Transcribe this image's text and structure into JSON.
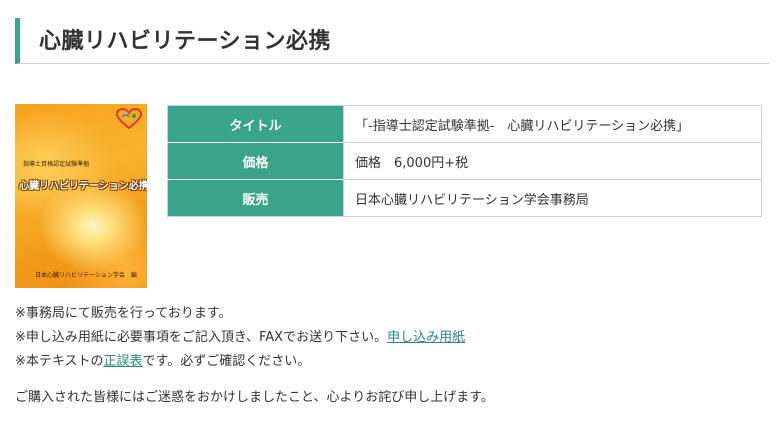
{
  "header": {
    "title": "心臓リハビリテーション必携"
  },
  "book_cover": {
    "small_title": "指導士資格認定試験準拠",
    "main_title": "心臓リハビリテーション必携",
    "publisher": "日本心臓リハビリテーション学会　編",
    "logo_icon": "jacr-heart-logo-icon"
  },
  "table": {
    "rows": [
      {
        "label": "タイトル",
        "value": "「-指導士認定試験準拠-　心臓リハビリテーション必携」"
      },
      {
        "label": "価格",
        "value": "価格　6,000円+税"
      },
      {
        "label": "販売",
        "value": "日本心臓リハビリテーション学会事務局"
      }
    ]
  },
  "notes": {
    "line1": "※事務局にて販売を行っております。",
    "line2_prefix": "※申し込み用紙に必要事項をご記入頂き、FAXでお送り下さい。",
    "line2_link": "申し込み用紙",
    "line3_prefix": "※本テキストの",
    "line3_link": "正誤表",
    "line3_suffix": "です。必ずご確認ください。"
  },
  "apology": "ご購入された皆様にはご迷惑をおかけしましたこと、心よりお詫び申し上げます。",
  "colors": {
    "accent": "#3aa48a",
    "link": "#2b8a73",
    "text": "#333333"
  }
}
